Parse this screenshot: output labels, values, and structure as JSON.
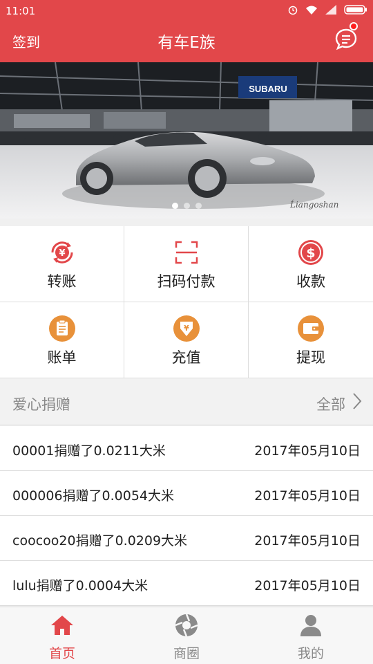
{
  "statusbar": {
    "time": "11:01"
  },
  "appbar": {
    "signin": "签到",
    "title": "有车E族"
  },
  "banner": {
    "sign": "SUBARU",
    "watermark": "Ĺiangoshan"
  },
  "actions": [
    {
      "label": "转账",
      "icon": "transfer-icon"
    },
    {
      "label": "扫码付款",
      "icon": "scan-icon"
    },
    {
      "label": "收款",
      "icon": "dollar-icon"
    },
    {
      "label": "账单",
      "icon": "bill-icon"
    },
    {
      "label": "充值",
      "icon": "recharge-icon"
    },
    {
      "label": "提现",
      "icon": "wallet-icon"
    }
  ],
  "section": {
    "title": "爱心捐赠",
    "all": "全部"
  },
  "donations": [
    {
      "text": "00001捐赠了0.0211大米",
      "date": "2017年05月10日"
    },
    {
      "text": "000006捐赠了0.0054大米",
      "date": "2017年05月10日"
    },
    {
      "text": "coocoo20捐赠了0.0209大米",
      "date": "2017年05月10日"
    },
    {
      "text": "lulu捐赠了0.0004大米",
      "date": "2017年05月10日"
    }
  ],
  "tabs": [
    {
      "label": "首页",
      "active": true
    },
    {
      "label": "商圈",
      "active": false
    },
    {
      "label": "我的",
      "active": false
    }
  ],
  "colors": {
    "primary": "#e2474a",
    "orange": "#e8913a"
  }
}
